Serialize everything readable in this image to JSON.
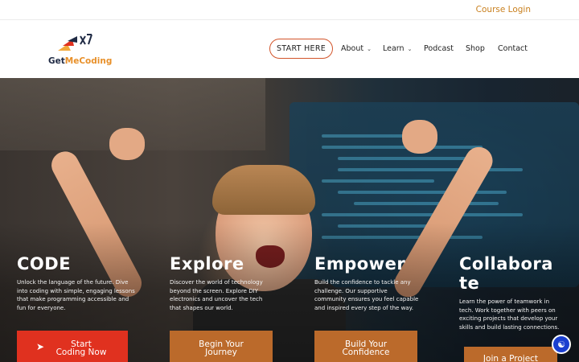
{
  "topbar": {
    "course_login": "Course Login"
  },
  "brand": {
    "name_get": "Get",
    "name_me": "Me",
    "name_coding": "Coding"
  },
  "nav": {
    "start_here": "START HERE",
    "items": [
      {
        "label": "About",
        "has_dropdown": true
      },
      {
        "label": "Learn",
        "has_dropdown": true
      },
      {
        "label": "Podcast",
        "has_dropdown": false
      },
      {
        "label": "Shop",
        "has_dropdown": false
      },
      {
        "label": "Contact",
        "has_dropdown": false
      }
    ]
  },
  "hero": {
    "columns": [
      {
        "title": "CODE",
        "text": "Unlock the language of the future. Dive into coding with simple, engaging lessons that make programming accessible and fun for everyone.",
        "cta": "Start Coding Now",
        "cta_icon": "rocket-icon"
      },
      {
        "title": "Explore",
        "text": "Discover the world of technology beyond the screen. Explore DIY electronics and uncover the tech that shapes our world.",
        "cta": "Begin Your Journey"
      },
      {
        "title": "Empower",
        "text": "Build the confidence to tackle any challenge. Our supportive community ensures you feel capable and inspired every step of the way.",
        "cta": "Build Your Confidence"
      },
      {
        "title": "Collaborate",
        "text": "Learn the power of teamwork in tech. Work together with peers on exciting projects that develop your skills and build lasting connections.",
        "cta": "Join a Project"
      }
    ]
  },
  "accessibility": {
    "icon": "accessibility-icon"
  },
  "colors": {
    "accent_orange": "#c9801f",
    "cta_red": "#e0311f",
    "cta_orange": "#bb6a2b",
    "start_border": "#d2542a",
    "a11y_blue": "#1b3fcf"
  }
}
